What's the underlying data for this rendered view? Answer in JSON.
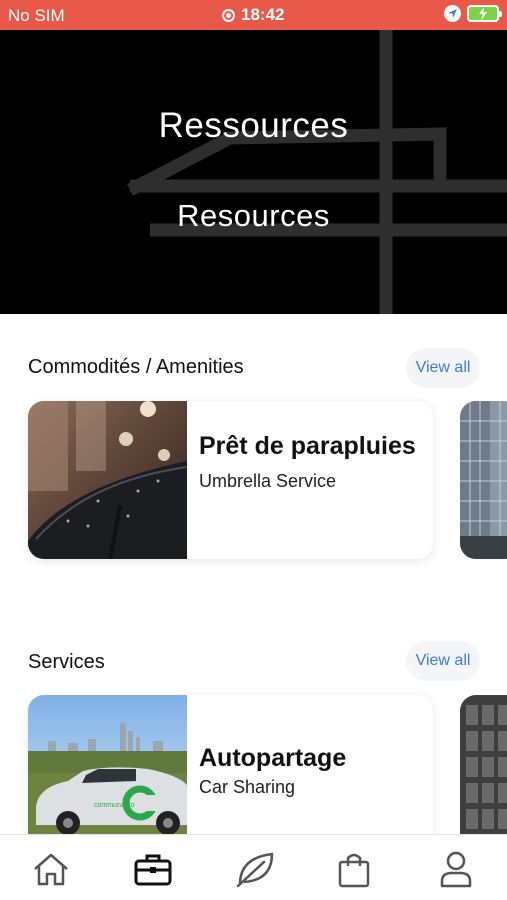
{
  "status_bar": {
    "carrier": "No SIM",
    "time": "18:42",
    "bg_color": "#e8594a"
  },
  "hero": {
    "title_fr": "Ressources",
    "title_en": "Resources"
  },
  "sections": [
    {
      "title": "Commodités / Amenities",
      "view_all": "View all",
      "card": {
        "title": "Prêt de parapluies",
        "subtitle": "Umbrella Service",
        "image": "umbrella-photo"
      }
    },
    {
      "title": "Services",
      "view_all": "View all",
      "card": {
        "title": "Autopartage",
        "subtitle": "Car Sharing",
        "image": "car-photo"
      }
    }
  ],
  "tab_bar": {
    "items": [
      {
        "icon": "home-icon"
      },
      {
        "icon": "briefcase-icon",
        "active": true
      },
      {
        "icon": "leaf-icon"
      },
      {
        "icon": "shopping-bag-icon"
      },
      {
        "icon": "profile-icon"
      }
    ],
    "accent": "#3b7be0"
  }
}
